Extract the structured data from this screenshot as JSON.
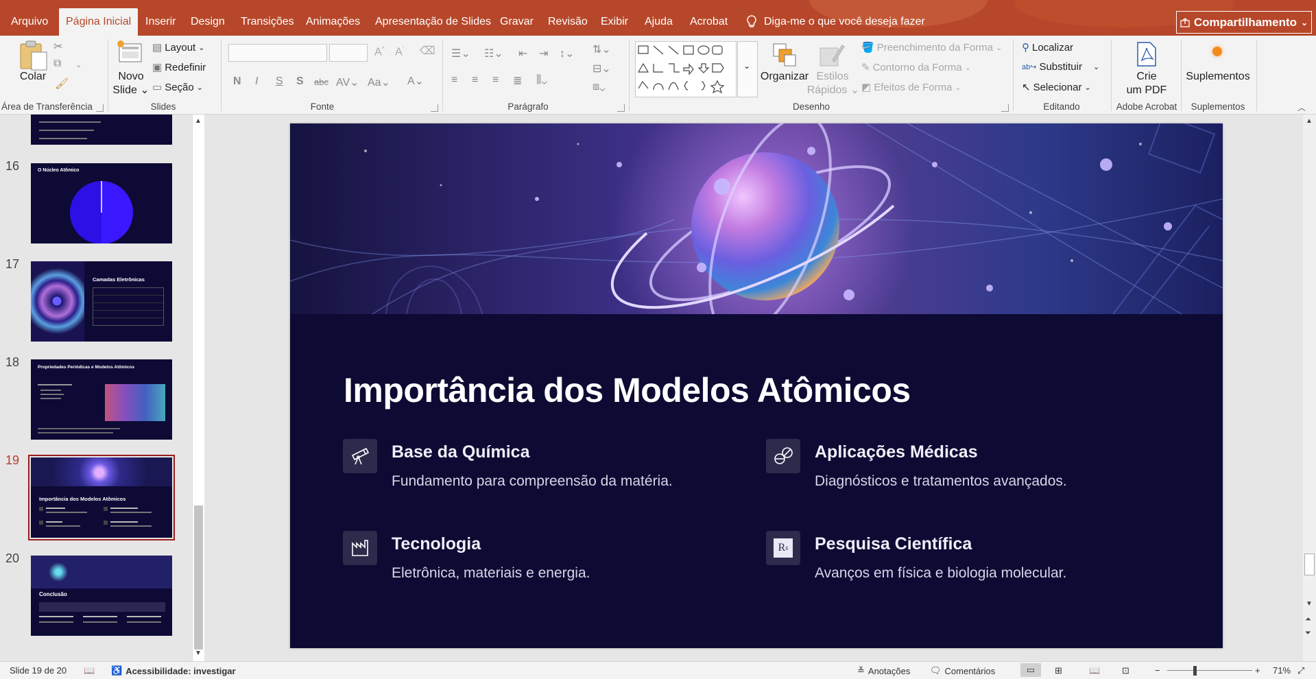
{
  "ribbon_tabs": [
    "Arquivo",
    "Página Inicial",
    "Inserir",
    "Design",
    "Transições",
    "Animações",
    "Apresentação de Slides",
    "Gravar",
    "Revisão",
    "Exibir",
    "Ajuda",
    "Acrobat"
  ],
  "active_tab": "Página Inicial",
  "tell_me": "Diga-me o que você deseja fazer",
  "share_label": "Compartilhamento",
  "clipboard": {
    "paste": "Colar",
    "group": "Área de Transferência"
  },
  "slides_group": {
    "new_slide_1": "Novo",
    "new_slide_2": "Slide",
    "layout": "Layout",
    "reset": "Redefinir",
    "section": "Seção",
    "group": "Slides"
  },
  "font_group": {
    "group": "Fonte"
  },
  "paragraph_group": {
    "group": "Parágrafo"
  },
  "drawing_group": {
    "arrange": "Organizar",
    "quick_styles_1": "Estilos",
    "quick_styles_2": "Rápidos",
    "shape_fill": "Preenchimento da Forma",
    "shape_outline": "Contorno da Forma",
    "shape_effects": "Efeitos de Forma",
    "group": "Desenho"
  },
  "editing_group": {
    "find": "Localizar",
    "replace": "Substituir",
    "select": "Selecionar",
    "group": "Editando"
  },
  "acrobat_group": {
    "create_1": "Crie",
    "create_2": "um PDF",
    "group": "Adobe Acrobat"
  },
  "addins_group": {
    "addins": "Suplementos",
    "group": "Suplementos"
  },
  "thumbnails": {
    "n16": "16",
    "t16": "O Núcleo Atômico",
    "n17": "17",
    "t17": "Camadas Eletrônicas",
    "n18": "18",
    "t18": "Propriedades Periódicas e Modelos Atômicos",
    "n19": "19",
    "t19": "Importância dos Modelos Atômicos",
    "n20": "20",
    "t20": "Conclusão"
  },
  "slide": {
    "title": "Importância dos Modelos Atômicos",
    "cards": [
      {
        "heading": "Base da Química",
        "text": "Fundamento para compreensão da matéria.",
        "icon": "telescope-icon"
      },
      {
        "heading": "Aplicações Médicas",
        "text": "Diagnósticos e tratamentos avançados.",
        "icon": "pills-icon"
      },
      {
        "heading": "Tecnologia",
        "text": "Eletrônica, materiais e energia.",
        "icon": "factory-icon"
      },
      {
        "heading": "Pesquisa Científica",
        "text": "Avanços em física e biologia molecular.",
        "icon": "r-squared-icon"
      }
    ]
  },
  "status": {
    "slide_counter": "Slide 19 de 20",
    "accessibility": "Acessibilidade: investigar",
    "notes": "Anotações",
    "comments": "Comentários",
    "zoom": "71%"
  },
  "colors": {
    "accent": "#b7472a",
    "slide_bg": "#0d0a33",
    "selected_thumb_border": "#9b1c1c"
  }
}
